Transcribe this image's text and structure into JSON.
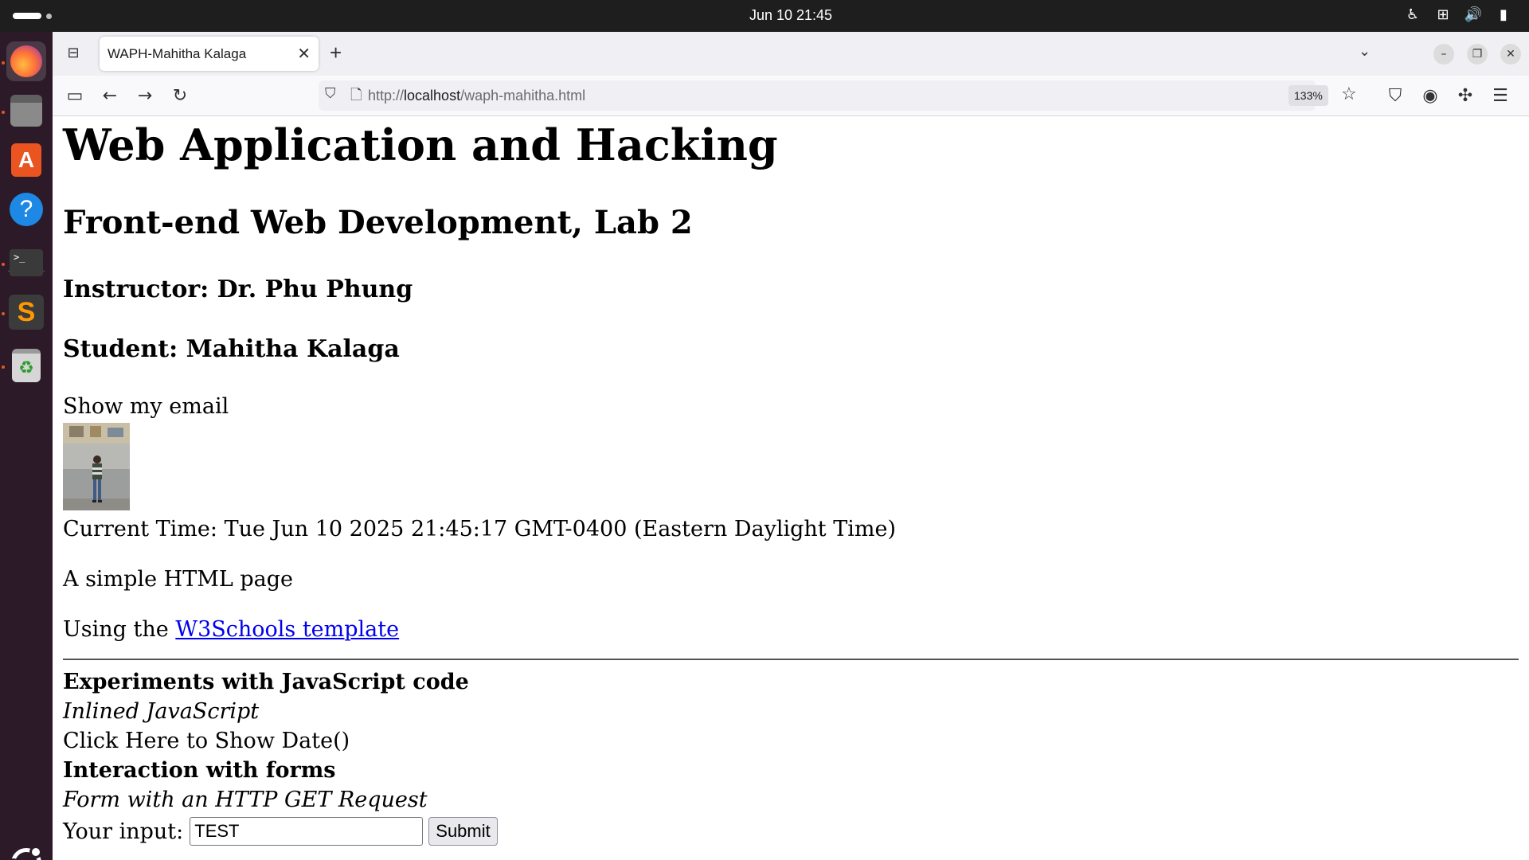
{
  "system": {
    "clock": "Jun 10  21:45"
  },
  "dock": {
    "items": [
      "firefox-icon",
      "files-icon",
      "app-center-icon",
      "help-icon",
      "terminal-icon",
      "sublime-text-icon",
      "trash-icon"
    ]
  },
  "browser": {
    "tab_title": "WAPH-Mahitha Kalaga",
    "url_prefix": "http://",
    "url_host": "localhost",
    "url_path": "/waph-mahitha.html",
    "zoom": "133%"
  },
  "page": {
    "h1": "Web Application and Hacking",
    "h2": "Front-end Web Development, Lab 2",
    "instructor": "Instructor: Dr. Phu Phung",
    "student": "Student: Mahitha Kalaga",
    "show_email": "Show my email",
    "current_time": "Current Time: Tue Jun 10 2025 21:45:17 GMT-0400 (Eastern Daylight Time)",
    "simple": "A simple HTML page",
    "using_prefix": "Using the ",
    "using_link": "W3Schools template",
    "experiments": "Experiments with JavaScript code",
    "inlined": "Inlined JavaScript",
    "click_date": "Click Here to Show Date()",
    "forms": "Interaction with forms",
    "get_request": "Form with an HTTP GET Request",
    "input_label": "Your input:",
    "input_value": "TEST",
    "submit_label": "Submit"
  },
  "colors": {
    "link": "#0000ee",
    "dock_bg": "#2c1a28",
    "topbar_bg": "#1e1e1e",
    "accent": "#e95420"
  }
}
